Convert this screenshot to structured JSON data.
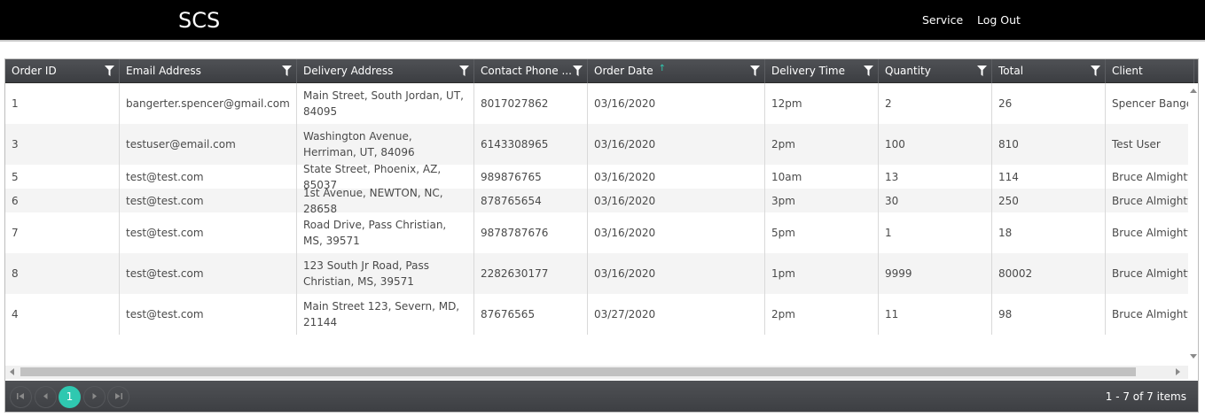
{
  "header": {
    "brand": "SCS",
    "nav": [
      "Service",
      "Log Out"
    ]
  },
  "grid": {
    "columns": [
      {
        "label": "Order ID",
        "filter": true
      },
      {
        "label": "Email Address",
        "filter": true
      },
      {
        "label": "Delivery Address",
        "filter": true
      },
      {
        "label": "Contact Phone ...",
        "filter": true
      },
      {
        "label": "Order Date",
        "filter": true,
        "sort": "ascending"
      },
      {
        "label": "Delivery Time",
        "filter": true
      },
      {
        "label": "Quantity",
        "filter": true
      },
      {
        "label": "Total",
        "filter": true
      },
      {
        "label": "Client",
        "filter": false
      }
    ],
    "rows": [
      [
        "1",
        "bangerter.spencer@gmail.com",
        "Main Street, South Jordan, UT, 84095",
        "8017027862",
        "03/16/2020",
        "12pm",
        "2",
        "26",
        "Spencer Bangerter"
      ],
      [
        "3",
        "testuser@email.com",
        "Washington Avenue, Herriman, UT, 84096",
        "6143308965",
        "03/16/2020",
        "2pm",
        "100",
        "810",
        "Test User"
      ],
      [
        "5",
        "test@test.com",
        "State Street, Phoenix, AZ, 85037",
        "989876765",
        "03/16/2020",
        "10am",
        "13",
        "114",
        "Bruce Almighty"
      ],
      [
        "6",
        "test@test.com",
        "1st Avenue, NEWTON, NC, 28658",
        "878765654",
        "03/16/2020",
        "3pm",
        "30",
        "250",
        "Bruce Almighty"
      ],
      [
        "7",
        "test@test.com",
        "Road Drive, Pass Christian, MS, 39571",
        "9878787676",
        "03/16/2020",
        "5pm",
        "1",
        "18",
        "Bruce Almighty"
      ],
      [
        "8",
        "test@test.com",
        "123 South Jr Road, Pass Christian, MS, 39571",
        "2282630177",
        "03/16/2020",
        "1pm",
        "9999",
        "80002",
        "Bruce Almighty"
      ],
      [
        "4",
        "test@test.com",
        "Main Street 123, Severn, MD, 21144",
        "87676565",
        "03/27/2020",
        "2pm",
        "11",
        "98",
        "Bruce Almighty"
      ]
    ]
  },
  "pager": {
    "first_icon": "first-page-icon",
    "prev_icon": "previous-page-icon",
    "current_page": "1",
    "next_icon": "next-page-icon",
    "last_icon": "last-page-icon",
    "info": "1 - 7 of 7 items"
  },
  "colors": {
    "accent": "#2fc8b0",
    "header_bg": "#000000",
    "grid_header_bg": "#45474b"
  }
}
